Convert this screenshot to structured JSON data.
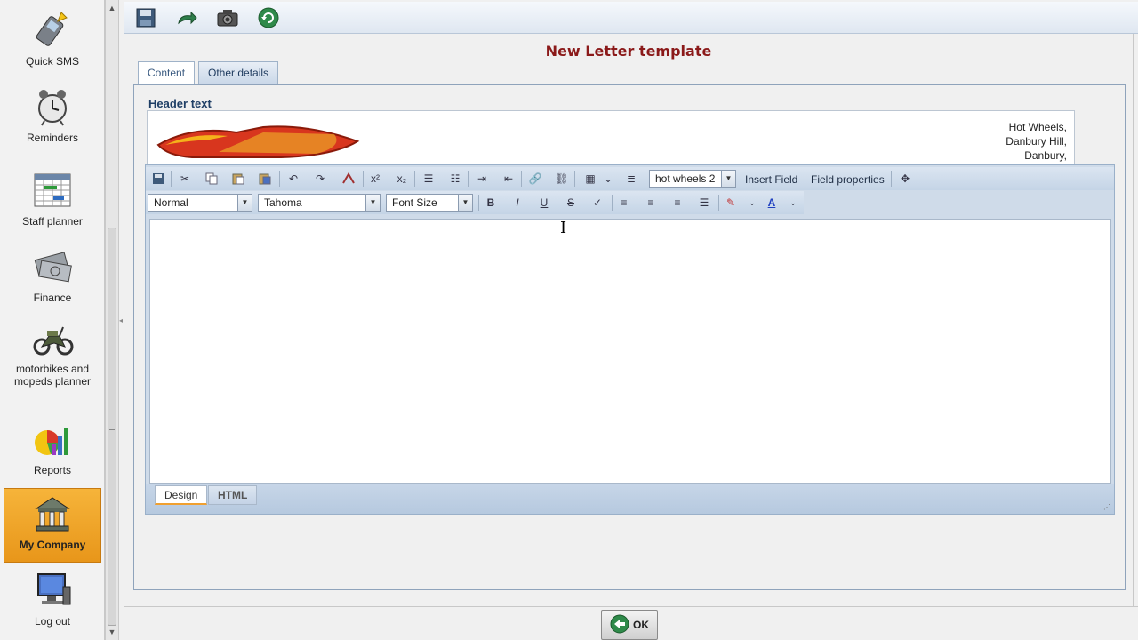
{
  "sidebar": {
    "items": [
      {
        "label": "Quick SMS",
        "icon": "phone-icon"
      },
      {
        "label": "Reminders",
        "icon": "alarm-clock-icon"
      },
      {
        "label": "Staff planner",
        "icon": "calendar-grid-icon"
      },
      {
        "label": "Finance",
        "icon": "money-icon"
      },
      {
        "label": "motorbikes and mopeds planner",
        "icon": "motorbike-icon"
      },
      {
        "label": "Reports",
        "icon": "chart-icon"
      },
      {
        "label": "My Company",
        "icon": "company-building-icon"
      },
      {
        "label": "Log out",
        "icon": "monitor-icon"
      }
    ],
    "active_index": 6
  },
  "toolbar": {
    "buttons": [
      "save-icon",
      "back-arrow-icon",
      "camera-icon",
      "refresh-icon"
    ]
  },
  "page": {
    "title": "New Letter template"
  },
  "tabs": {
    "content": "Content",
    "other": "Other details"
  },
  "header": {
    "label": "Header text",
    "logo_text": "Hot Wheels",
    "address_lines": [
      "Hot Wheels,",
      "Danbury Hill,",
      "Danbury,"
    ]
  },
  "editor": {
    "field_select": "hot wheels 2",
    "insert_field": "Insert Field",
    "field_properties": "Field properties",
    "format_select": "Normal",
    "font_select": "Tahoma",
    "size_select": "Font Size",
    "bold": "B",
    "italic": "I",
    "underline": "U",
    "strike": "S",
    "mode_design": "Design",
    "mode_html": "HTML"
  },
  "footer": {
    "ok": "OK"
  },
  "colors": {
    "title": "#8b1a1a",
    "active_nav": "#f0a030",
    "header_label": "#1f3f66"
  }
}
